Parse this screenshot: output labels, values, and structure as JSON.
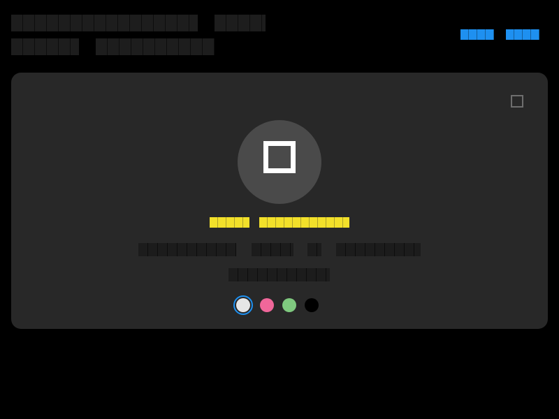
{
  "header": {
    "title": "",
    "title_suffix": "",
    "meta_left": "",
    "meta_right": "",
    "links": [
      "",
      ""
    ]
  },
  "card": {
    "highlight_words": [
      "",
      ""
    ],
    "description_words": [
      "",
      "",
      "",
      ""
    ],
    "description_line2": "",
    "close_label": ""
  },
  "colors": {
    "accent": "#1e90f0",
    "highlight": "#f2e02a",
    "card_background": "#282828",
    "avatar_background": "#4a4a4a"
  },
  "swatches": [
    {
      "color": "#e6e6e6",
      "selected": true
    },
    {
      "color": "#f0679a",
      "selected": false
    },
    {
      "color": "#7fc97f",
      "selected": false
    },
    {
      "color": "#000000",
      "selected": false
    }
  ],
  "icons": {
    "close": "close-icon",
    "avatar": "square-icon"
  }
}
